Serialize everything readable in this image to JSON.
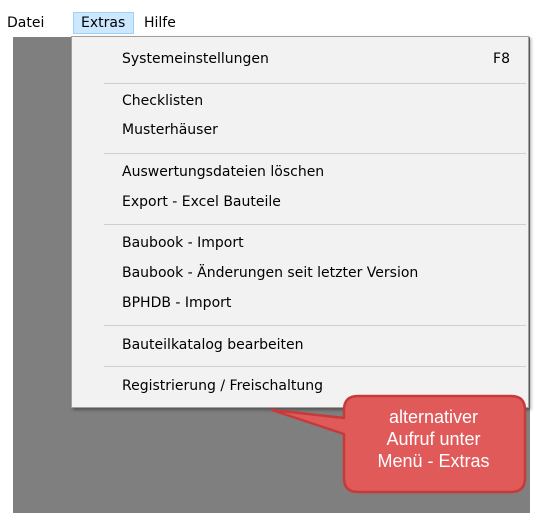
{
  "menubar": {
    "items": [
      {
        "label": "Datei"
      },
      {
        "label": "Extras"
      },
      {
        "label": "Hilfe"
      }
    ]
  },
  "extras_menu": {
    "items": [
      {
        "label": "Systemeinstellungen",
        "shortcut": "F8"
      },
      {
        "label": "Checklisten"
      },
      {
        "label": "Musterhäuser"
      },
      {
        "label": "Auswertungsdateien löschen"
      },
      {
        "label": "Export - Excel Bauteile"
      },
      {
        "label": "Baubook - Import"
      },
      {
        "label": "Baubook - Änderungen seit letzter Version"
      },
      {
        "label": "BPHDB - Import"
      },
      {
        "label": "Bauteilkatalog bearbeiten"
      },
      {
        "label": "Registrierung / Freischaltung"
      }
    ]
  },
  "callout": {
    "lines": [
      "alternativer",
      "Aufruf unter",
      "Menü - Extras"
    ],
    "fill_color": "#e05a5a",
    "border_color": "#c73a3a"
  },
  "colors": {
    "workspace": "#7f7f7f",
    "menu_background": "#f2f2f2",
    "active_menubar_item": "#cce8ff"
  }
}
